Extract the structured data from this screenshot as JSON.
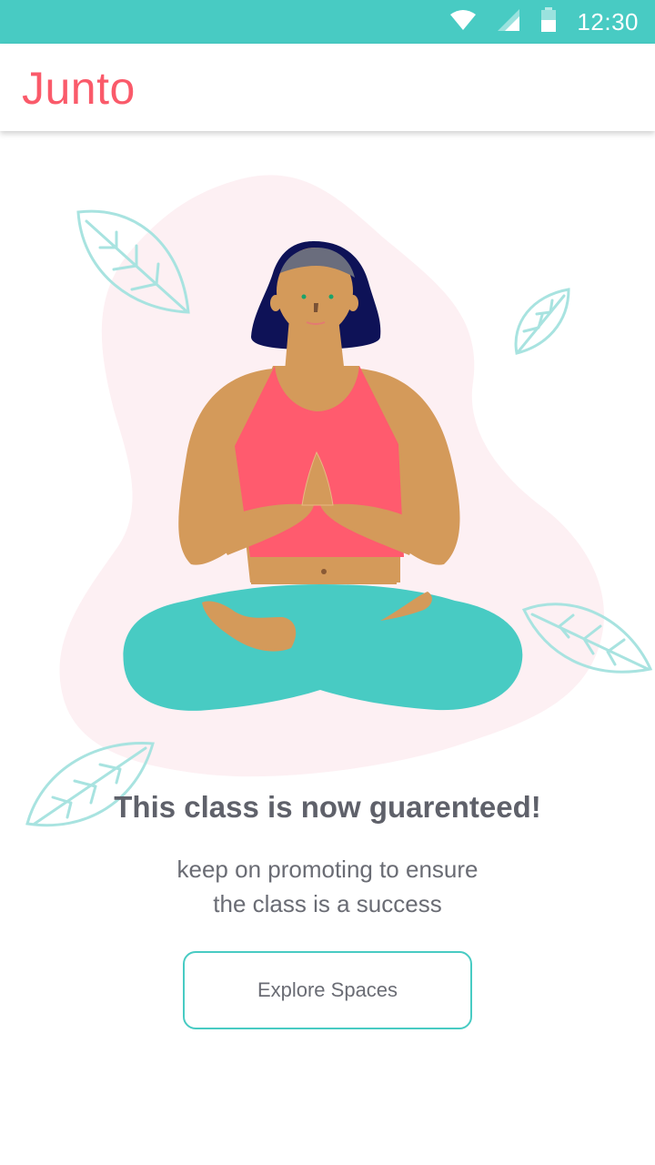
{
  "status_bar": {
    "time": "12:30",
    "icons": [
      "wifi-icon",
      "cellular-signal-icon",
      "battery-icon"
    ]
  },
  "app_bar": {
    "title": "Junto"
  },
  "main": {
    "illustration": "meditation-illustration",
    "headline": "This class is now guarenteed!",
    "subtext_line1": "keep on promoting to ensure",
    "subtext_line2": "the class is a success",
    "button_label": "Explore Spaces"
  },
  "colors": {
    "accent_teal": "#48cbc3",
    "brand_coral": "#fa5a6a",
    "text_gray": "#5f616a",
    "blob_pink": "#fdf0f3"
  }
}
